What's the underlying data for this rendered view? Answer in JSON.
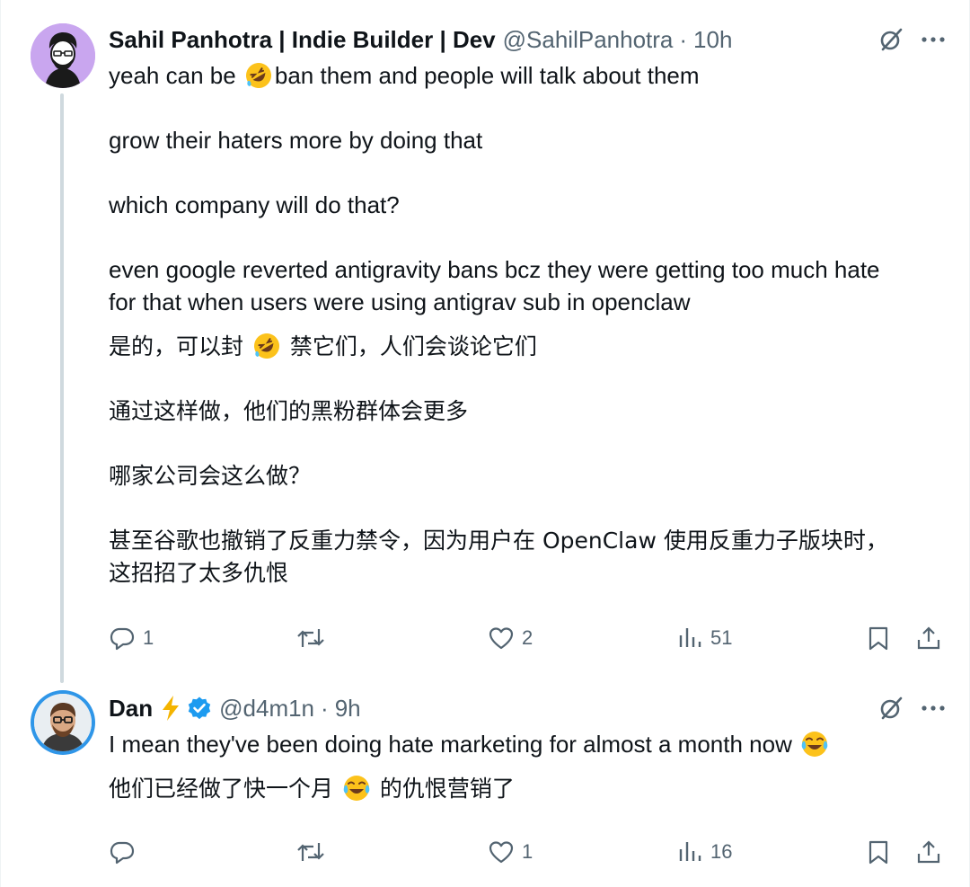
{
  "tweets": [
    {
      "name": "Sahil Panhotra | Indie Builder | Dev",
      "handle": "@SahilPanhotra",
      "separator": "·",
      "time": "10h",
      "body_en": {
        "l1a": "yeah can be ",
        "l1b": "ban them and people will talk about them",
        "l2": "grow their haters more by doing that",
        "l3": "which company will do that?",
        "l4": "even google reverted antigravity bans bcz they were getting too much hate",
        "l5": "for that when users were using antigrav sub in openclaw"
      },
      "body_zh": {
        "l1a": "是的，可以封 ",
        "l1b": " 禁它们，人们会谈论它们",
        "l2": "通过这样做，他们的黑粉群体会更多",
        "l3": "哪家公司会这么做？",
        "l4": "甚至谷歌也撤销了反重力禁令，因为用户在 OpenClaw 使用反重力子版块时，",
        "l5": "这招招了太多仇恨"
      },
      "stats": {
        "replies": "1",
        "retweets": "",
        "likes": "2",
        "views": "51"
      }
    },
    {
      "name": "Dan",
      "handle": "@d4m1n",
      "separator": "·",
      "time": "9h",
      "body_en": {
        "l1": "I mean they've been doing hate marketing for almost a month now "
      },
      "body_zh": {
        "l1a": "他们已经做了快一个月 ",
        "l1b": " 的仇恨营销了"
      },
      "stats": {
        "replies": "",
        "retweets": "",
        "likes": "1",
        "views": "16"
      }
    }
  ],
  "icons": {
    "grok": "grok-icon",
    "more": "more-icon",
    "reply": "reply-icon",
    "retweet": "retweet-icon",
    "like": "like-icon",
    "views": "views-icon",
    "bookmark": "bookmark-icon",
    "share": "share-icon",
    "bolt": "lightning-bolt-icon",
    "verified": "verified-badge-icon",
    "emoji_rofl": "rolling-on-floor-laughing-emoji",
    "emoji_joy": "face-with-tears-of-joy-emoji"
  },
  "colors": {
    "text": "#0f1419",
    "secondary": "#536471",
    "verified": "#1d9bf0",
    "thread_line": "#cfd9de",
    "bolt": "#f4b400"
  }
}
